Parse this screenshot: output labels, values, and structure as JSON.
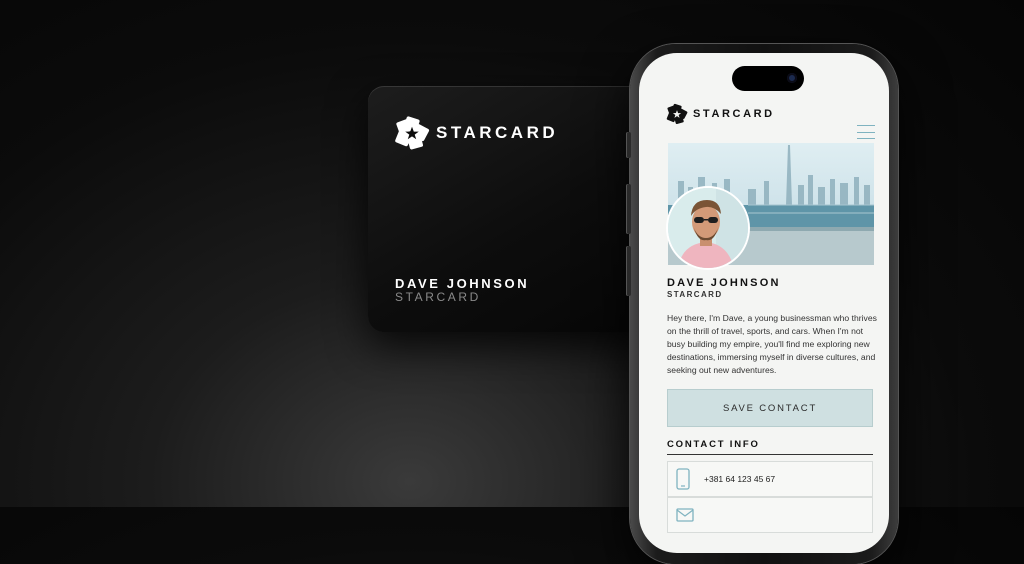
{
  "card": {
    "brand": "STARCARD",
    "holder_name": "DAVE JOHNSON",
    "holder_sub": "STARCARD"
  },
  "phone": {
    "header": {
      "brand": "STARCARD",
      "menu_icon": "hamburger-menu-icon"
    },
    "profile": {
      "name": "DAVE JOHNSON",
      "subtitle": "STARCARD",
      "bio": "Hey there, I'm Dave, a young businessman who thrives on the thrill of travel, sports, and cars. When I'm not busy building my empire, you'll find me exploring new destinations, immersing myself in diverse cultures, and seeking out new adventures."
    },
    "save_contact_label": "SAVE CONTACT",
    "contact_info": {
      "title": "CONTACT INFO",
      "items": [
        {
          "icon": "phone-icon",
          "value": "+381 64 123 45 67"
        },
        {
          "icon": "email-icon",
          "value": ""
        }
      ]
    }
  },
  "colors": {
    "accent": "#7fb3c0",
    "button_bg": "#cfe0e1",
    "screen_bg": "#f4f5f3",
    "card_bg": "#0d0d0d"
  }
}
